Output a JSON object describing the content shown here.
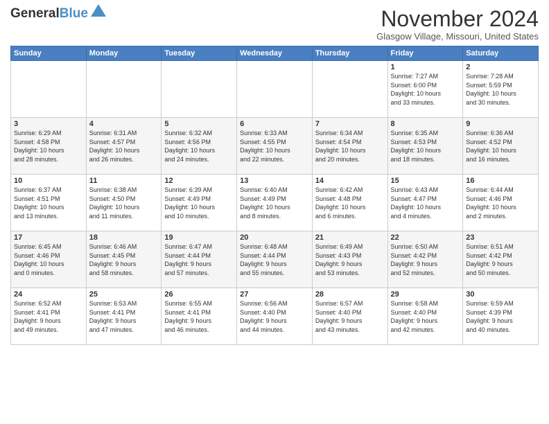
{
  "header": {
    "logo_line1": "General",
    "logo_line2": "Blue",
    "month_title": "November 2024",
    "location": "Glasgow Village, Missouri, United States"
  },
  "weekdays": [
    "Sunday",
    "Monday",
    "Tuesday",
    "Wednesday",
    "Thursday",
    "Friday",
    "Saturday"
  ],
  "weeks": [
    [
      {
        "day": "",
        "info": ""
      },
      {
        "day": "",
        "info": ""
      },
      {
        "day": "",
        "info": ""
      },
      {
        "day": "",
        "info": ""
      },
      {
        "day": "",
        "info": ""
      },
      {
        "day": "1",
        "info": "Sunrise: 7:27 AM\nSunset: 6:00 PM\nDaylight: 10 hours\nand 33 minutes."
      },
      {
        "day": "2",
        "info": "Sunrise: 7:28 AM\nSunset: 5:59 PM\nDaylight: 10 hours\nand 30 minutes."
      }
    ],
    [
      {
        "day": "3",
        "info": "Sunrise: 6:29 AM\nSunset: 4:58 PM\nDaylight: 10 hours\nand 28 minutes."
      },
      {
        "day": "4",
        "info": "Sunrise: 6:31 AM\nSunset: 4:57 PM\nDaylight: 10 hours\nand 26 minutes."
      },
      {
        "day": "5",
        "info": "Sunrise: 6:32 AM\nSunset: 4:56 PM\nDaylight: 10 hours\nand 24 minutes."
      },
      {
        "day": "6",
        "info": "Sunrise: 6:33 AM\nSunset: 4:55 PM\nDaylight: 10 hours\nand 22 minutes."
      },
      {
        "day": "7",
        "info": "Sunrise: 6:34 AM\nSunset: 4:54 PM\nDaylight: 10 hours\nand 20 minutes."
      },
      {
        "day": "8",
        "info": "Sunrise: 6:35 AM\nSunset: 4:53 PM\nDaylight: 10 hours\nand 18 minutes."
      },
      {
        "day": "9",
        "info": "Sunrise: 6:36 AM\nSunset: 4:52 PM\nDaylight: 10 hours\nand 16 minutes."
      }
    ],
    [
      {
        "day": "10",
        "info": "Sunrise: 6:37 AM\nSunset: 4:51 PM\nDaylight: 10 hours\nand 13 minutes."
      },
      {
        "day": "11",
        "info": "Sunrise: 6:38 AM\nSunset: 4:50 PM\nDaylight: 10 hours\nand 11 minutes."
      },
      {
        "day": "12",
        "info": "Sunrise: 6:39 AM\nSunset: 4:49 PM\nDaylight: 10 hours\nand 10 minutes."
      },
      {
        "day": "13",
        "info": "Sunrise: 6:40 AM\nSunset: 4:49 PM\nDaylight: 10 hours\nand 8 minutes."
      },
      {
        "day": "14",
        "info": "Sunrise: 6:42 AM\nSunset: 4:48 PM\nDaylight: 10 hours\nand 6 minutes."
      },
      {
        "day": "15",
        "info": "Sunrise: 6:43 AM\nSunset: 4:47 PM\nDaylight: 10 hours\nand 4 minutes."
      },
      {
        "day": "16",
        "info": "Sunrise: 6:44 AM\nSunset: 4:46 PM\nDaylight: 10 hours\nand 2 minutes."
      }
    ],
    [
      {
        "day": "17",
        "info": "Sunrise: 6:45 AM\nSunset: 4:46 PM\nDaylight: 10 hours\nand 0 minutes."
      },
      {
        "day": "18",
        "info": "Sunrise: 6:46 AM\nSunset: 4:45 PM\nDaylight: 9 hours\nand 58 minutes."
      },
      {
        "day": "19",
        "info": "Sunrise: 6:47 AM\nSunset: 4:44 PM\nDaylight: 9 hours\nand 57 minutes."
      },
      {
        "day": "20",
        "info": "Sunrise: 6:48 AM\nSunset: 4:44 PM\nDaylight: 9 hours\nand 55 minutes."
      },
      {
        "day": "21",
        "info": "Sunrise: 6:49 AM\nSunset: 4:43 PM\nDaylight: 9 hours\nand 53 minutes."
      },
      {
        "day": "22",
        "info": "Sunrise: 6:50 AM\nSunset: 4:42 PM\nDaylight: 9 hours\nand 52 minutes."
      },
      {
        "day": "23",
        "info": "Sunrise: 6:51 AM\nSunset: 4:42 PM\nDaylight: 9 hours\nand 50 minutes."
      }
    ],
    [
      {
        "day": "24",
        "info": "Sunrise: 6:52 AM\nSunset: 4:41 PM\nDaylight: 9 hours\nand 49 minutes."
      },
      {
        "day": "25",
        "info": "Sunrise: 6:53 AM\nSunset: 4:41 PM\nDaylight: 9 hours\nand 47 minutes."
      },
      {
        "day": "26",
        "info": "Sunrise: 6:55 AM\nSunset: 4:41 PM\nDaylight: 9 hours\nand 46 minutes."
      },
      {
        "day": "27",
        "info": "Sunrise: 6:56 AM\nSunset: 4:40 PM\nDaylight: 9 hours\nand 44 minutes."
      },
      {
        "day": "28",
        "info": "Sunrise: 6:57 AM\nSunset: 4:40 PM\nDaylight: 9 hours\nand 43 minutes."
      },
      {
        "day": "29",
        "info": "Sunrise: 6:58 AM\nSunset: 4:40 PM\nDaylight: 9 hours\nand 42 minutes."
      },
      {
        "day": "30",
        "info": "Sunrise: 6:59 AM\nSunset: 4:39 PM\nDaylight: 9 hours\nand 40 minutes."
      }
    ]
  ]
}
